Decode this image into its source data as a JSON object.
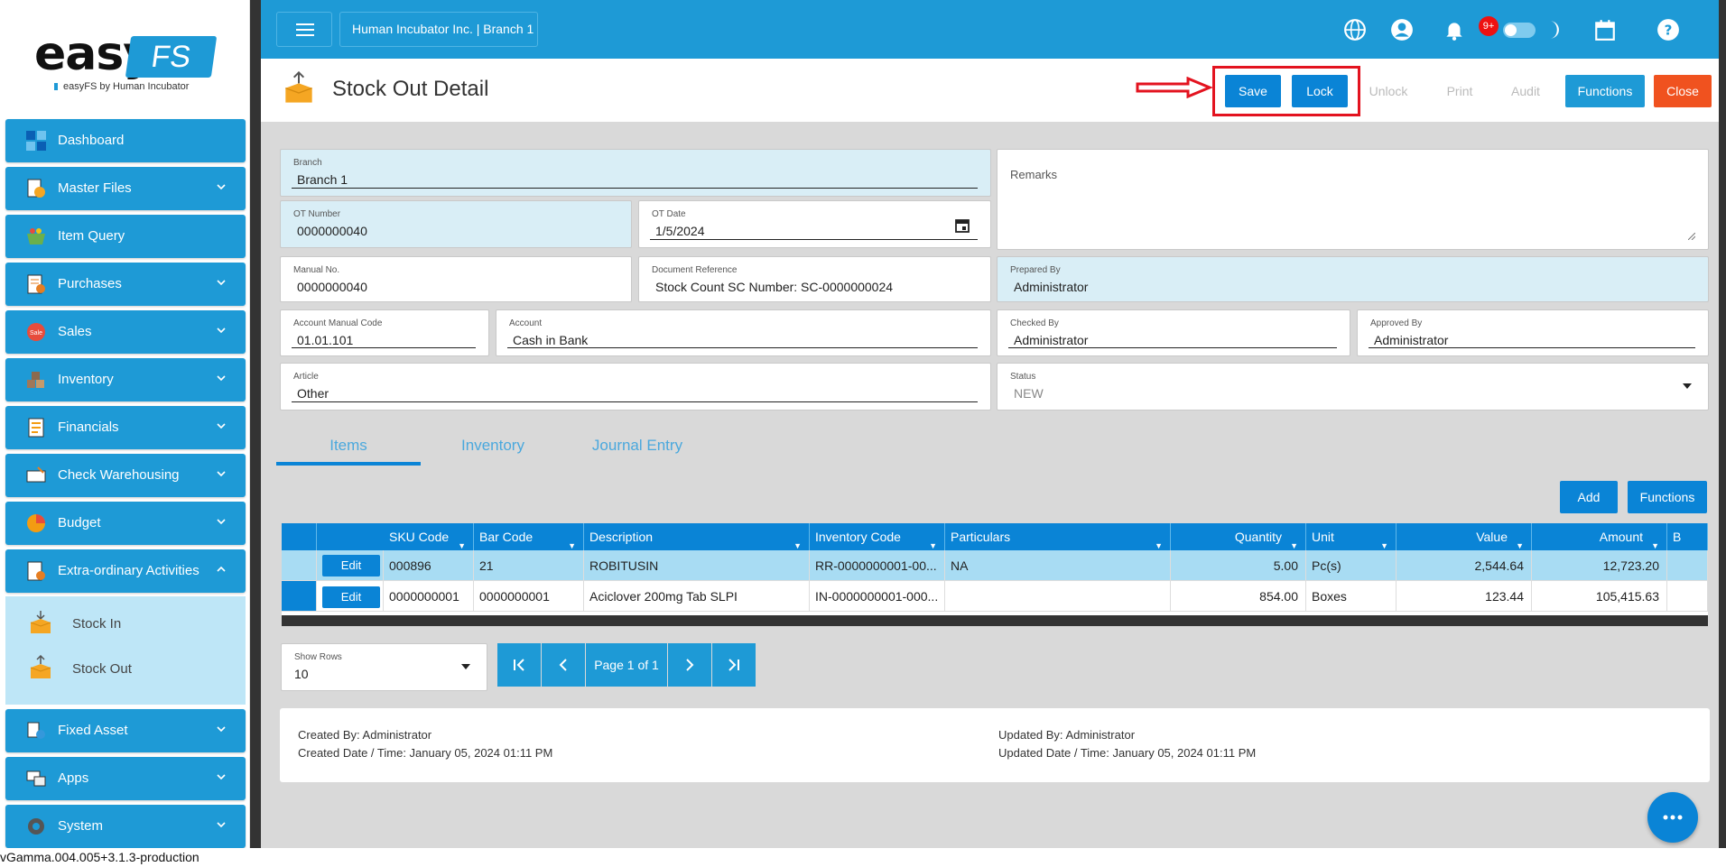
{
  "logo": {
    "easy": "easy",
    "fs": "FS",
    "tagline": "easyFS by Human Incubator"
  },
  "sidebar": {
    "items": [
      {
        "label": "Dashboard",
        "icon": "dashboard-icon"
      },
      {
        "label": "Master Files",
        "icon": "master-files-icon"
      },
      {
        "label": "Item Query",
        "icon": "basket-icon"
      },
      {
        "label": "Purchases",
        "icon": "purchases-icon"
      },
      {
        "label": "Sales",
        "icon": "sale-tag-icon"
      },
      {
        "label": "Inventory",
        "icon": "inventory-icon"
      },
      {
        "label": "Financials",
        "icon": "financials-icon"
      },
      {
        "label": "Check Warehousing",
        "icon": "check-icon"
      },
      {
        "label": "Budget",
        "icon": "pie-chart-icon"
      },
      {
        "label": "Extra-ordinary Activities",
        "icon": "activities-icon"
      },
      {
        "label": "Fixed Asset",
        "icon": "fixed-asset-icon"
      },
      {
        "label": "Apps",
        "icon": "apps-icon"
      },
      {
        "label": "System",
        "icon": "gear-icon"
      }
    ],
    "subitems": [
      {
        "label": "Stock In",
        "icon": "stock-in-box-icon"
      },
      {
        "label": "Stock Out",
        "icon": "stock-out-box-icon"
      }
    ]
  },
  "topbar": {
    "company": "Human Incubator Inc. | Branch 1",
    "notif_count": "9+"
  },
  "header": {
    "title": "Stock Out Detail",
    "buttons": {
      "save": "Save",
      "lock": "Lock",
      "unlock": "Unlock",
      "print": "Print",
      "audit": "Audit",
      "functions": "Functions",
      "close": "Close"
    }
  },
  "form": {
    "branch": {
      "label": "Branch",
      "value": "Branch 1"
    },
    "remarks": {
      "label": "Remarks",
      "value": ""
    },
    "ot_number": {
      "label": "OT Number",
      "value": "0000000040"
    },
    "ot_date": {
      "label": "OT Date",
      "value": "1/5/2024"
    },
    "manual_no": {
      "label": "Manual No.",
      "value": "0000000040"
    },
    "doc_ref": {
      "label": "Document Reference",
      "value": "Stock Count SC Number: SC-0000000024"
    },
    "prepared_by": {
      "label": "Prepared By",
      "value": "Administrator"
    },
    "account_manual_code": {
      "label": "Account Manual Code",
      "value": "01.01.101"
    },
    "account": {
      "label": "Account",
      "value": "Cash in Bank"
    },
    "checked_by": {
      "label": "Checked By",
      "value": "Administrator"
    },
    "approved_by": {
      "label": "Approved By",
      "value": "Administrator"
    },
    "article": {
      "label": "Article",
      "value": "Other"
    },
    "status": {
      "label": "Status",
      "value": "NEW"
    }
  },
  "tabs": {
    "items": "Items",
    "inventory": "Inventory",
    "journal": "Journal Entry"
  },
  "grid_actions": {
    "add": "Add",
    "functions": "Functions"
  },
  "table": {
    "columns": [
      "SKU Code",
      "Bar Code",
      "Description",
      "Inventory Code",
      "Particulars",
      "Quantity",
      "Unit",
      "Value",
      "Amount",
      "B"
    ],
    "edit_label": "Edit",
    "rows": [
      {
        "sku": "000896",
        "bar": "21",
        "desc": "ROBITUSIN",
        "inv": "RR-0000000001-00...",
        "part": "NA",
        "qty": "5.00",
        "unit": "Pc(s)",
        "value": "2,544.64",
        "amount": "12,723.20"
      },
      {
        "sku": "0000000001",
        "bar": "0000000001",
        "desc": "Aciclover 200mg Tab SLPI",
        "inv": "IN-0000000001-000...",
        "part": "",
        "qty": "854.00",
        "unit": "Boxes",
        "value": "123.44",
        "amount": "105,415.63"
      }
    ]
  },
  "pagination": {
    "show_rows_label": "Show Rows",
    "show_rows_value": "10",
    "page_text": "Page 1 of 1"
  },
  "audit": {
    "created_by": "Created By: Administrator",
    "created_date": "Created Date / Time: January 05, 2024 01:11 PM",
    "updated_by": "Updated By: Administrator",
    "updated_date": "Updated Date / Time: January 05, 2024 01:11 PM"
  },
  "version": "vGamma.004.005+3.1.3-production",
  "colors": {
    "primary": "#1e9ad6",
    "button": "#0a84d6",
    "close": "#f0521f",
    "highlight": "#e3131f"
  }
}
